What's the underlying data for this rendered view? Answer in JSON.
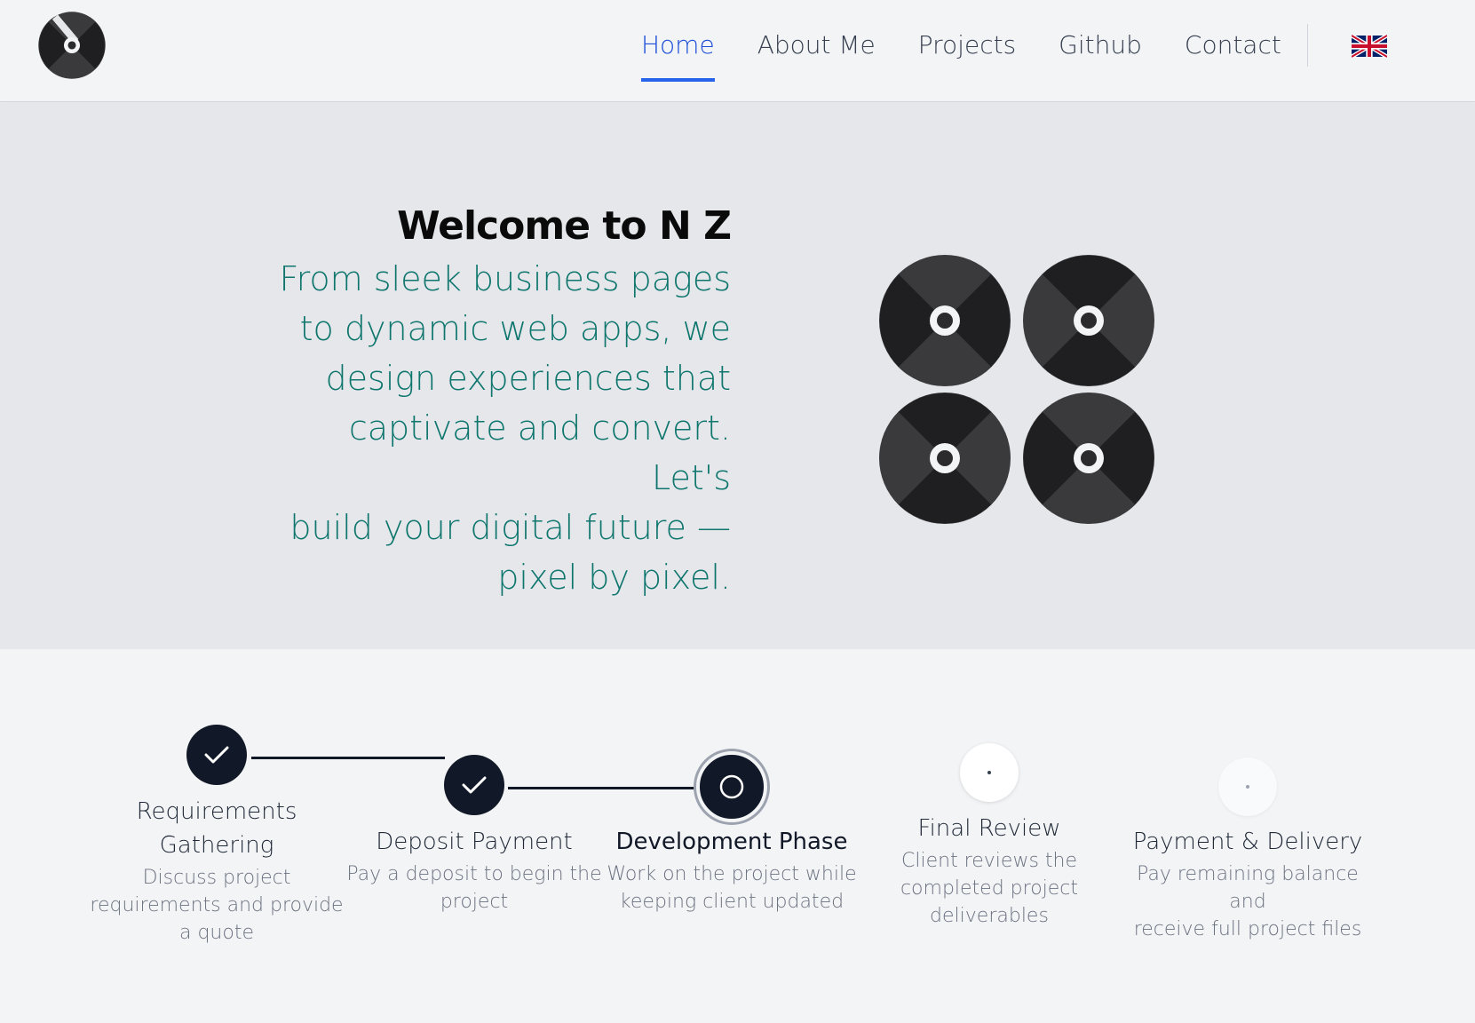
{
  "nav": {
    "items": [
      {
        "label": "Home",
        "active": true
      },
      {
        "label": "About Me",
        "active": false
      },
      {
        "label": "Projects",
        "active": false
      },
      {
        "label": "Github",
        "active": false
      },
      {
        "label": "Contact",
        "active": false
      }
    ],
    "language_icon": "uk-flag-icon",
    "accent_color": "#2563eb"
  },
  "hero": {
    "title": "Welcome to N Z",
    "subtitle_lines": [
      "From sleek business pages",
      "to dynamic web apps, we",
      "design experiences that",
      "captivate and convert. Let's",
      "build your digital future —",
      "pixel by pixel."
    ],
    "subtitle_color": "#0f766e"
  },
  "steps": [
    {
      "title_lines": [
        "Requirements",
        "Gathering"
      ],
      "desc_lines": [
        "Discuss project",
        "requirements and provide",
        "a quote"
      ],
      "status": "done"
    },
    {
      "title_lines": [
        "Deposit Payment"
      ],
      "desc_lines": [
        "Pay a deposit to begin the",
        "project"
      ],
      "status": "done"
    },
    {
      "title_lines": [
        "Development Phase"
      ],
      "desc_lines": [
        "Work on the project while",
        "keeping client updated"
      ],
      "status": "current"
    },
    {
      "title_lines": [
        "Final Review"
      ],
      "desc_lines": [
        "Client reviews the",
        "completed project",
        "deliverables"
      ],
      "status": "upcoming"
    },
    {
      "title_lines": [
        "Payment & Delivery"
      ],
      "desc_lines": [
        "Pay remaining balance and",
        "receive full project files"
      ],
      "status": "upcoming"
    }
  ]
}
